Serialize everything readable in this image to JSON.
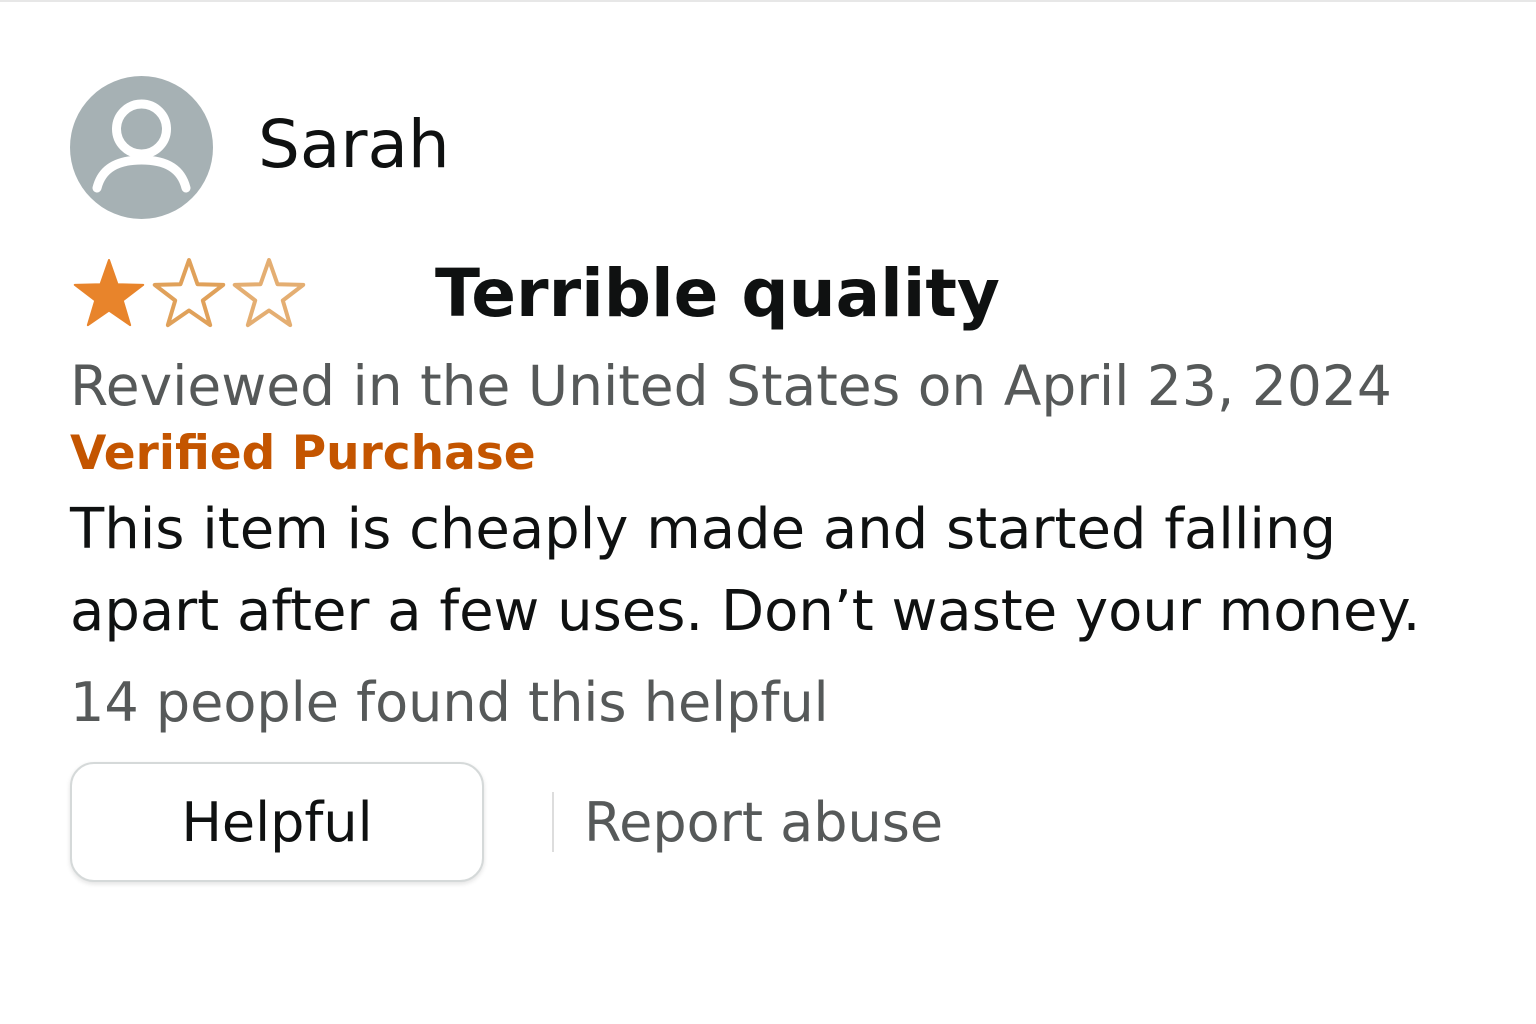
{
  "profile": {
    "name": "Sarah",
    "avatar_icon": "user-silhouette-icon"
  },
  "rating": {
    "value": 1,
    "max": 3,
    "filled_color": "#e8842b",
    "empty_stroke_color": "#e0a15a"
  },
  "review": {
    "title": "Terrible quality",
    "date_line": "Reviewed in the United States on April 23, 2024",
    "verified_label": "Verified Purchase",
    "verified_color": "#c45500",
    "body": "This item is cheaply made and started falling apart after a few uses. Don’t waste your money.",
    "helpful_count_text": "14 people found this helpful"
  },
  "actions": {
    "helpful_label": "Helpful",
    "report_label": "Report abuse"
  }
}
